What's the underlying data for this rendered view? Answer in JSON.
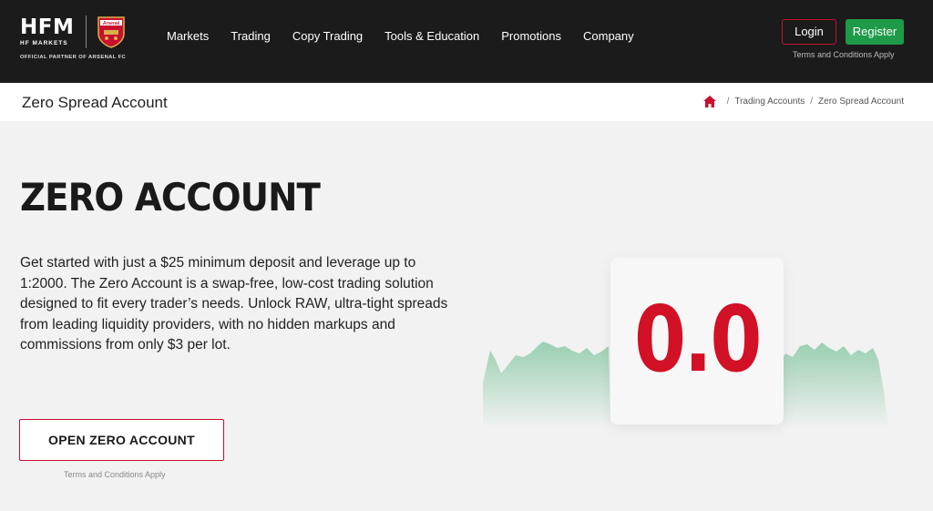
{
  "header": {
    "logo_text": "HFM",
    "logo_sub": "HF MARKETS",
    "logo_partner": "OFFICIAL PARTNER OF ARSENAL FC",
    "crest_text": "Arsenal",
    "nav": [
      "Markets",
      "Trading",
      "Copy Trading",
      "Tools & Education",
      "Promotions",
      "Company"
    ],
    "login_label": "Login",
    "register_label": "Register",
    "terms": "Terms and Conditions Apply"
  },
  "subheader": {
    "title": "Zero Spread Account",
    "breadcrumb": [
      "Trading Accounts",
      "Zero Spread Account"
    ]
  },
  "hero": {
    "title": "ZERO ACCOUNT",
    "description": "Get started with just a $25 minimum deposit and leverage up to 1:2000. The Zero Account is a swap-free, low-cost trading solution designed to fit every trader’s needs. Unlock RAW, ultra-tight spreads from leading liquidity providers, with no hidden markups and commissions from only $3 per lot.",
    "cta_label": "OPEN ZERO ACCOUNT",
    "cta_terms": "Terms and Conditions Apply",
    "spread_value": "0.0"
  },
  "colors": {
    "brand_red": "#c8102e",
    "register_green": "#1f9a48",
    "header_bg": "#1b1b1b",
    "chart_green": "#7cc49a"
  },
  "icons": {
    "home": "home-icon",
    "crest": "arsenal-crest-icon"
  }
}
